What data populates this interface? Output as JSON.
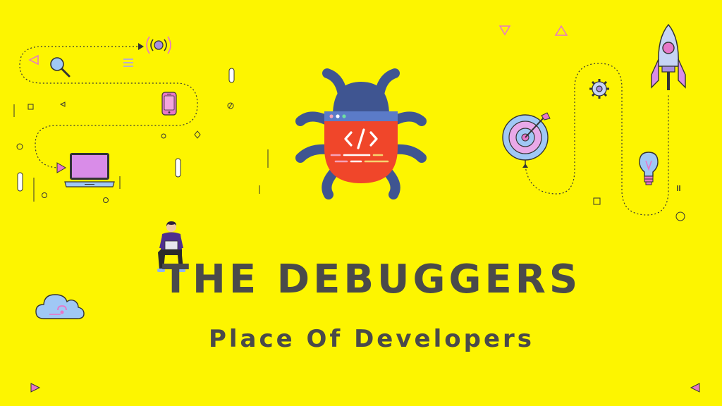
{
  "brand": {
    "title": "THE DEBUGGERS",
    "tagline": "Place Of Developers"
  },
  "colors": {
    "background": "#FDF500",
    "text": "#4a4a4a",
    "bug_body": "#3F5591",
    "bug_shell": "#F0462A",
    "code_bar": "#5B7BC8",
    "accent_pink": "#E776C8",
    "accent_purple": "#A98FE0",
    "accent_blue": "#8FB6F0",
    "line": "#333333"
  },
  "icons": [
    "bug-icon",
    "rocket-icon",
    "target-icon",
    "gear-icon",
    "lightbulb-icon",
    "laptop-icon",
    "smartphone-icon",
    "search-icon",
    "signal-icon",
    "cloud-icon",
    "developer-figure"
  ]
}
